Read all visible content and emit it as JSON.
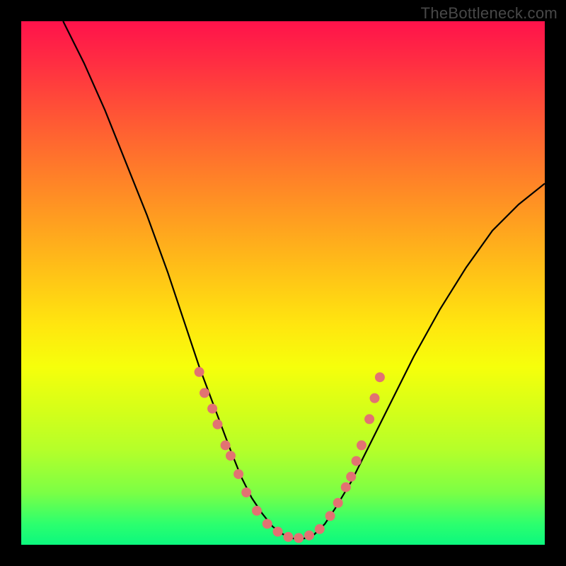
{
  "watermark": "TheBottleneck.com",
  "chart_data": {
    "type": "line",
    "title": "",
    "xlabel": "",
    "ylabel": "",
    "xlim": [
      0,
      100
    ],
    "ylim": [
      0,
      100
    ],
    "series": [
      {
        "name": "curve",
        "x": [
          8,
          12,
          16,
          20,
          24,
          28,
          31,
          34,
          37,
          40,
          42,
          44,
          46,
          48,
          50,
          52,
          54,
          56,
          58,
          60,
          63,
          66,
          70,
          75,
          80,
          85,
          90,
          95,
          100
        ],
        "y": [
          100,
          92,
          83,
          73,
          63,
          52,
          43,
          34,
          26,
          18,
          13,
          9,
          6,
          3.5,
          2,
          1.2,
          1.2,
          2,
          4,
          7,
          12,
          18,
          26,
          36,
          45,
          53,
          60,
          65,
          69
        ]
      }
    ],
    "markers": [
      {
        "x": 34,
        "y": 33
      },
      {
        "x": 35,
        "y": 29
      },
      {
        "x": 36.5,
        "y": 26
      },
      {
        "x": 37.5,
        "y": 23
      },
      {
        "x": 39,
        "y": 19
      },
      {
        "x": 40,
        "y": 17
      },
      {
        "x": 41.5,
        "y": 13.5
      },
      {
        "x": 43,
        "y": 10
      },
      {
        "x": 45,
        "y": 6.5
      },
      {
        "x": 47,
        "y": 4
      },
      {
        "x": 49,
        "y": 2.5
      },
      {
        "x": 51,
        "y": 1.5
      },
      {
        "x": 53,
        "y": 1.3
      },
      {
        "x": 55,
        "y": 1.8
      },
      {
        "x": 57,
        "y": 3
      },
      {
        "x": 59,
        "y": 5.5
      },
      {
        "x": 60.5,
        "y": 8
      },
      {
        "x": 62,
        "y": 11
      },
      {
        "x": 63,
        "y": 13
      },
      {
        "x": 64,
        "y": 16
      },
      {
        "x": 65,
        "y": 19
      },
      {
        "x": 66.5,
        "y": 24
      },
      {
        "x": 67.5,
        "y": 28
      },
      {
        "x": 68.5,
        "y": 32
      }
    ],
    "marker_color": "#e27272",
    "curve_color": "#000000"
  }
}
